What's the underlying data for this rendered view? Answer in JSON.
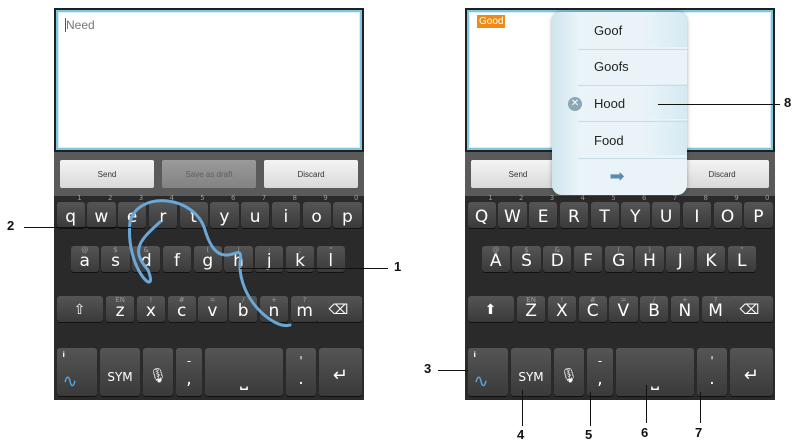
{
  "left_phone": {
    "text_field": {
      "value": "Need"
    },
    "actions": {
      "send": "Send",
      "save_draft": "Save as draft",
      "discard": "Discard"
    },
    "number_hints": [
      "1",
      "2",
      "3",
      "4",
      "5",
      "6",
      "7",
      "8",
      "9",
      "0"
    ],
    "row1": [
      {
        "letter": "q"
      },
      {
        "letter": "w"
      },
      {
        "letter": "e"
      },
      {
        "letter": "r"
      },
      {
        "letter": "t"
      },
      {
        "letter": "y"
      },
      {
        "letter": "u"
      },
      {
        "letter": "i"
      },
      {
        "letter": "o"
      },
      {
        "letter": "p"
      }
    ],
    "row2": [
      {
        "letter": "a",
        "hint": "@"
      },
      {
        "letter": "s",
        "hint": "$"
      },
      {
        "letter": "d",
        "hint": "&"
      },
      {
        "letter": "f",
        "hint": "_"
      },
      {
        "letter": "g",
        "hint": "("
      },
      {
        "letter": "h",
        "hint": ")"
      },
      {
        "letter": "j",
        "hint": ":"
      },
      {
        "letter": "k",
        "hint": ";"
      },
      {
        "letter": "l",
        "hint": "\""
      }
    ],
    "row3": [
      {
        "letter": "z",
        "hint": "EN"
      },
      {
        "letter": "x",
        "hint": "!"
      },
      {
        "letter": "c",
        "hint": "#"
      },
      {
        "letter": "v",
        "hint": "="
      },
      {
        "letter": "b",
        "hint": "/"
      },
      {
        "letter": "n",
        "hint": "+"
      },
      {
        "letter": "m",
        "hint": "?"
      }
    ],
    "bottom": {
      "info_hint": "i",
      "sym": "SYM",
      "dash_hint": "-",
      "comma": ",",
      "apostrophe_hint": "'",
      "period": "."
    }
  },
  "right_phone": {
    "text_field": {
      "value": "Good"
    },
    "actions": {
      "send": "Send",
      "discard": "Discard"
    },
    "number_hints": [
      "1",
      "2",
      "3",
      "4",
      "5",
      "6",
      "7",
      "8",
      "9",
      "0"
    ],
    "row1": [
      {
        "letter": "Q"
      },
      {
        "letter": "W"
      },
      {
        "letter": "E"
      },
      {
        "letter": "R"
      },
      {
        "letter": "T"
      },
      {
        "letter": "Y"
      },
      {
        "letter": "U"
      },
      {
        "letter": "I"
      },
      {
        "letter": "O"
      },
      {
        "letter": "P"
      }
    ],
    "row2": [
      {
        "letter": "A",
        "hint": "@"
      },
      {
        "letter": "S",
        "hint": "$"
      },
      {
        "letter": "D",
        "hint": "&"
      },
      {
        "letter": "F",
        "hint": "_"
      },
      {
        "letter": "G",
        "hint": "("
      },
      {
        "letter": "H",
        "hint": ")"
      },
      {
        "letter": "J",
        "hint": ":"
      },
      {
        "letter": "K",
        "hint": ";"
      },
      {
        "letter": "L",
        "hint": "\""
      }
    ],
    "row3": [
      {
        "letter": "Z",
        "hint": "EN"
      },
      {
        "letter": "X",
        "hint": "!"
      },
      {
        "letter": "C",
        "hint": "#"
      },
      {
        "letter": "V",
        "hint": "="
      },
      {
        "letter": "B",
        "hint": "/"
      },
      {
        "letter": "N",
        "hint": "+"
      },
      {
        "letter": "M",
        "hint": "?"
      }
    ],
    "bottom": {
      "info_hint": "i",
      "sym": "SYM",
      "dash_hint": "-",
      "comma": ",",
      "apostrophe_hint": "'",
      "period": "."
    },
    "suggestions": [
      "Goof",
      "Goofs",
      "Hood",
      "Food"
    ]
  },
  "callouts": {
    "c1": "1",
    "c2": "2",
    "c3": "3",
    "c4": "4",
    "c5": "5",
    "c6": "6",
    "c7": "7",
    "c8": "8"
  },
  "icons": {
    "shift": "shift-icon",
    "backspace": "backspace-icon",
    "mic": "microphone-icon",
    "enter": "enter-icon",
    "space": "space-icon",
    "swype": "swype-logo-icon",
    "next": "arrow-right-icon",
    "delete_word": "remove-icon"
  },
  "colors": {
    "trace": "#6aa8d8",
    "field_border": "#7fc6df",
    "highlight": "#ef8a16"
  }
}
